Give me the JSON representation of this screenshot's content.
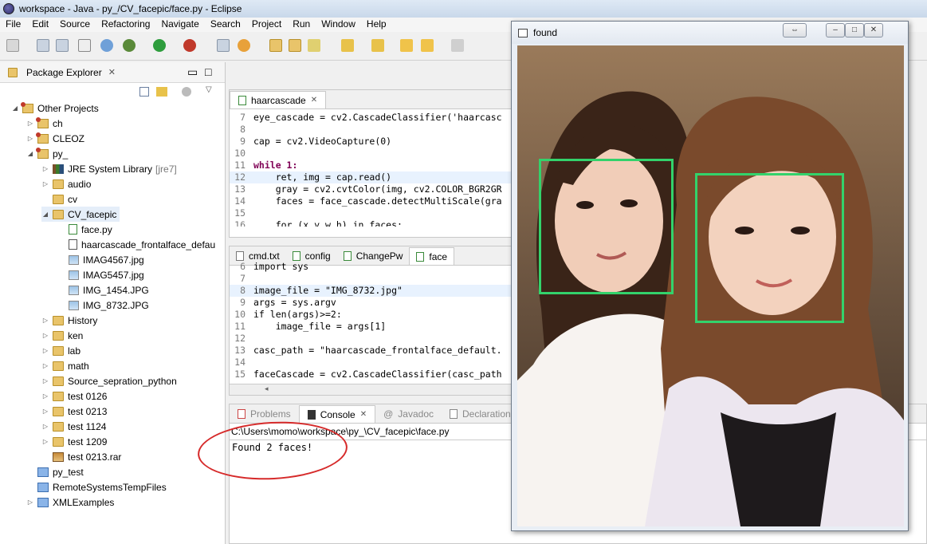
{
  "window": {
    "title": "workspace - Java - py_/CV_facepic/face.py - Eclipse"
  },
  "menu": [
    "File",
    "Edit",
    "Source",
    "Refactoring",
    "Navigate",
    "Search",
    "Project",
    "Run",
    "Window",
    "Help"
  ],
  "package_explorer": {
    "title": "Package Explorer",
    "items": [
      {
        "label": "Other Projects"
      },
      {
        "label": "ch"
      },
      {
        "label": "CLEOZ"
      },
      {
        "label": "py_"
      },
      {
        "label": "JRE System Library",
        "suffix": "[jre7]"
      },
      {
        "label": "audio"
      },
      {
        "label": "cv"
      },
      {
        "label": "CV_facepic"
      },
      {
        "label": "face.py"
      },
      {
        "label": "haarcascade_frontalface_defau"
      },
      {
        "label": "IMAG4567.jpg"
      },
      {
        "label": "IMAG5457.jpg"
      },
      {
        "label": "IMG_1454.JPG"
      },
      {
        "label": "IMG_8732.JPG"
      },
      {
        "label": "History"
      },
      {
        "label": "ken"
      },
      {
        "label": "lab"
      },
      {
        "label": "math"
      },
      {
        "label": "Source_sepration_python"
      },
      {
        "label": "test 0126"
      },
      {
        "label": "test 0213"
      },
      {
        "label": "test 1124"
      },
      {
        "label": "test 1209"
      },
      {
        "label": "test 0213.rar"
      },
      {
        "label": "py_test"
      },
      {
        "label": "RemoteSystemsTempFiles"
      },
      {
        "label": "XMLExamples"
      }
    ]
  },
  "editor_top": {
    "tab": "haarcascade",
    "lines": [
      {
        "n": "7",
        "text": "eye_cascade = cv2.CascadeClassifier('haarcasc"
      },
      {
        "n": "8",
        "text": ""
      },
      {
        "n": "9",
        "text": "cap = cv2.VideoCapture(0)"
      },
      {
        "n": "10",
        "text": ""
      },
      {
        "n": "11",
        "text": "while 1:"
      },
      {
        "n": "12",
        "text": "    ret, img = cap.read()"
      },
      {
        "n": "13",
        "text": "    gray = cv2.cvtColor(img, cv2.COLOR_BGR2GR"
      },
      {
        "n": "14",
        "text": "    faces = face_cascade.detectMultiScale(gra"
      },
      {
        "n": "15",
        "text": ""
      },
      {
        "n": "16",
        "text": "    for (x,y,w,h) in faces:"
      }
    ]
  },
  "editor_bottom": {
    "tabs": [
      "cmd.txt",
      "config",
      "ChangePw",
      "face"
    ],
    "lines": [
      {
        "n": "6",
        "text": "import sys"
      },
      {
        "n": "7",
        "text": ""
      },
      {
        "n": "8",
        "text": "image_file = \"IMG_8732.jpg\""
      },
      {
        "n": "9",
        "text": "args = sys.argv"
      },
      {
        "n": "10",
        "text": "if len(args)>=2:"
      },
      {
        "n": "11",
        "text": "    image_file = args[1]"
      },
      {
        "n": "12",
        "text": ""
      },
      {
        "n": "13",
        "text": "casc_path = \"haarcascade_frontalface_default."
      },
      {
        "n": "14",
        "text": ""
      },
      {
        "n": "15",
        "text": "faceCascade = cv2.CascadeClassifier(casc_path"
      }
    ]
  },
  "console": {
    "tabs": [
      "Problems",
      "Console",
      "Javadoc",
      "Declaration"
    ],
    "path": "C:\\Users\\momo\\workspace\\py_\\CV_facepic\\face.py",
    "output": "Found 2 faces!"
  },
  "found_window": {
    "title": "found"
  },
  "colors": {
    "face_box": "#33d26b",
    "annotation": "#d62a2a"
  }
}
